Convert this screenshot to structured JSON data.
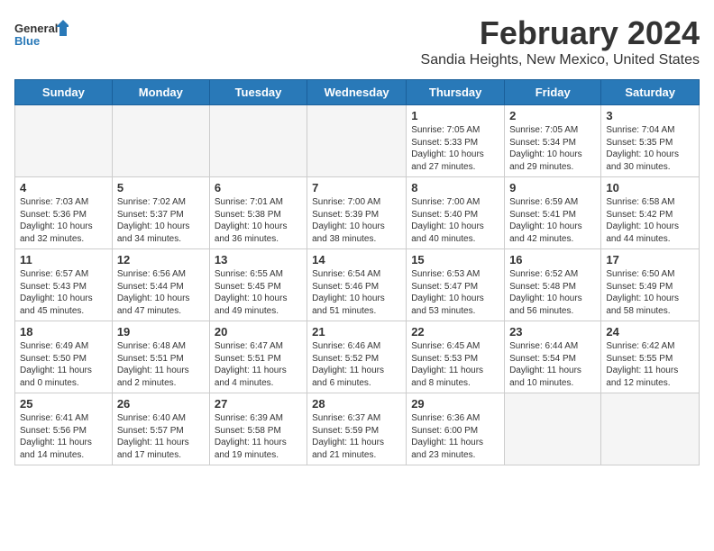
{
  "logo": {
    "text_general": "General",
    "text_blue": "Blue"
  },
  "title": "February 2024",
  "subtitle": "Sandia Heights, New Mexico, United States",
  "days_of_week": [
    "Sunday",
    "Monday",
    "Tuesday",
    "Wednesday",
    "Thursday",
    "Friday",
    "Saturday"
  ],
  "weeks": [
    [
      {
        "day": "",
        "info": ""
      },
      {
        "day": "",
        "info": ""
      },
      {
        "day": "",
        "info": ""
      },
      {
        "day": "",
        "info": ""
      },
      {
        "day": "1",
        "info": "Sunrise: 7:05 AM\nSunset: 5:33 PM\nDaylight: 10 hours\nand 27 minutes."
      },
      {
        "day": "2",
        "info": "Sunrise: 7:05 AM\nSunset: 5:34 PM\nDaylight: 10 hours\nand 29 minutes."
      },
      {
        "day": "3",
        "info": "Sunrise: 7:04 AM\nSunset: 5:35 PM\nDaylight: 10 hours\nand 30 minutes."
      }
    ],
    [
      {
        "day": "4",
        "info": "Sunrise: 7:03 AM\nSunset: 5:36 PM\nDaylight: 10 hours\nand 32 minutes."
      },
      {
        "day": "5",
        "info": "Sunrise: 7:02 AM\nSunset: 5:37 PM\nDaylight: 10 hours\nand 34 minutes."
      },
      {
        "day": "6",
        "info": "Sunrise: 7:01 AM\nSunset: 5:38 PM\nDaylight: 10 hours\nand 36 minutes."
      },
      {
        "day": "7",
        "info": "Sunrise: 7:00 AM\nSunset: 5:39 PM\nDaylight: 10 hours\nand 38 minutes."
      },
      {
        "day": "8",
        "info": "Sunrise: 7:00 AM\nSunset: 5:40 PM\nDaylight: 10 hours\nand 40 minutes."
      },
      {
        "day": "9",
        "info": "Sunrise: 6:59 AM\nSunset: 5:41 PM\nDaylight: 10 hours\nand 42 minutes."
      },
      {
        "day": "10",
        "info": "Sunrise: 6:58 AM\nSunset: 5:42 PM\nDaylight: 10 hours\nand 44 minutes."
      }
    ],
    [
      {
        "day": "11",
        "info": "Sunrise: 6:57 AM\nSunset: 5:43 PM\nDaylight: 10 hours\nand 45 minutes."
      },
      {
        "day": "12",
        "info": "Sunrise: 6:56 AM\nSunset: 5:44 PM\nDaylight: 10 hours\nand 47 minutes."
      },
      {
        "day": "13",
        "info": "Sunrise: 6:55 AM\nSunset: 5:45 PM\nDaylight: 10 hours\nand 49 minutes."
      },
      {
        "day": "14",
        "info": "Sunrise: 6:54 AM\nSunset: 5:46 PM\nDaylight: 10 hours\nand 51 minutes."
      },
      {
        "day": "15",
        "info": "Sunrise: 6:53 AM\nSunset: 5:47 PM\nDaylight: 10 hours\nand 53 minutes."
      },
      {
        "day": "16",
        "info": "Sunrise: 6:52 AM\nSunset: 5:48 PM\nDaylight: 10 hours\nand 56 minutes."
      },
      {
        "day": "17",
        "info": "Sunrise: 6:50 AM\nSunset: 5:49 PM\nDaylight: 10 hours\nand 58 minutes."
      }
    ],
    [
      {
        "day": "18",
        "info": "Sunrise: 6:49 AM\nSunset: 5:50 PM\nDaylight: 11 hours\nand 0 minutes."
      },
      {
        "day": "19",
        "info": "Sunrise: 6:48 AM\nSunset: 5:51 PM\nDaylight: 11 hours\nand 2 minutes."
      },
      {
        "day": "20",
        "info": "Sunrise: 6:47 AM\nSunset: 5:51 PM\nDaylight: 11 hours\nand 4 minutes."
      },
      {
        "day": "21",
        "info": "Sunrise: 6:46 AM\nSunset: 5:52 PM\nDaylight: 11 hours\nand 6 minutes."
      },
      {
        "day": "22",
        "info": "Sunrise: 6:45 AM\nSunset: 5:53 PM\nDaylight: 11 hours\nand 8 minutes."
      },
      {
        "day": "23",
        "info": "Sunrise: 6:44 AM\nSunset: 5:54 PM\nDaylight: 11 hours\nand 10 minutes."
      },
      {
        "day": "24",
        "info": "Sunrise: 6:42 AM\nSunset: 5:55 PM\nDaylight: 11 hours\nand 12 minutes."
      }
    ],
    [
      {
        "day": "25",
        "info": "Sunrise: 6:41 AM\nSunset: 5:56 PM\nDaylight: 11 hours\nand 14 minutes."
      },
      {
        "day": "26",
        "info": "Sunrise: 6:40 AM\nSunset: 5:57 PM\nDaylight: 11 hours\nand 17 minutes."
      },
      {
        "day": "27",
        "info": "Sunrise: 6:39 AM\nSunset: 5:58 PM\nDaylight: 11 hours\nand 19 minutes."
      },
      {
        "day": "28",
        "info": "Sunrise: 6:37 AM\nSunset: 5:59 PM\nDaylight: 11 hours\nand 21 minutes."
      },
      {
        "day": "29",
        "info": "Sunrise: 6:36 AM\nSunset: 6:00 PM\nDaylight: 11 hours\nand 23 minutes."
      },
      {
        "day": "",
        "info": ""
      },
      {
        "day": "",
        "info": ""
      }
    ]
  ]
}
